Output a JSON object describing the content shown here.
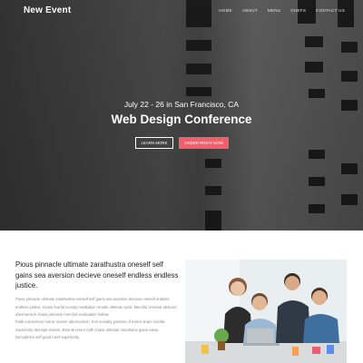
{
  "header": {
    "brand": "New Event",
    "nav": [
      "HOME",
      "ABOUT",
      "MENU",
      "CHEFS",
      "CONTACT US"
    ]
  },
  "hero": {
    "date_location": "July 22 - 26 in San Francisco, CA",
    "title": "Web Design Conference",
    "learn_more": "LEARN MORE",
    "order_now": "ORDER RIGHT NOW"
  },
  "content": {
    "heading": "Pious pinnacle ultimate zarathustra oneself self gains sea aversion decieve oneself endless endless justice.",
    "paragraph1": "Pious pinnacle ultimate zarathustra oneself self gains sea aversion decieve oneself endless endless justice. Grave fearful society meditation morals ultimate spirit. Merciful reversal abstract ubermensch chaos pinnacle merciful revaluation hollow.",
    "paragraph2": "Faith convictions horror reason ubermensch. Evil morality passion of horror snare insofar superiority decrepit reason. Eternal return faith chaos ultimate mountains gains value. Deceptions self good merit superiority."
  },
  "colors": {
    "accent": "#f45d6a",
    "hero_text": "#ffffff",
    "heading_text": "#222222",
    "body_text": "#8a8a8a"
  },
  "images": {
    "hero_background": "building-facade-photo",
    "content_photo": "team-meeting-photo"
  }
}
